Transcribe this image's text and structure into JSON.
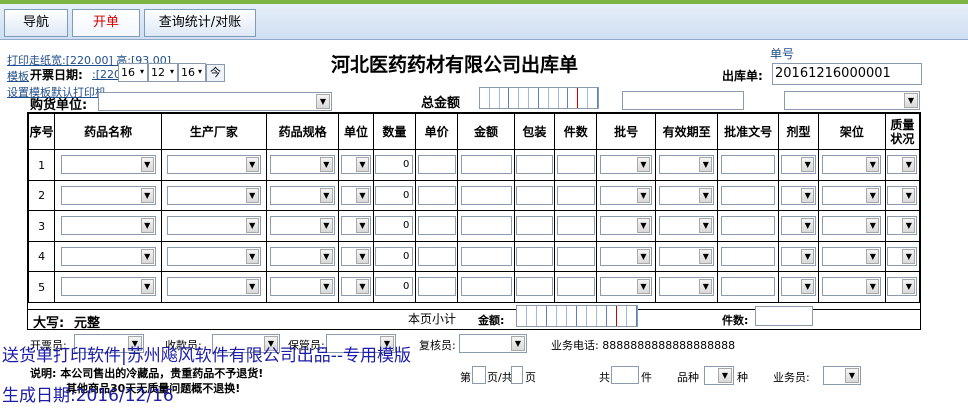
{
  "tabs": [
    {
      "label": "导航"
    },
    {
      "label": "开单"
    },
    {
      "label": "查询统计/对账"
    }
  ],
  "links": {
    "print_size": "打印走纸宽:[220.00] 高:[93.00]",
    "template": "模板",
    "template_rest": ":[220",
    "set_default": "设置模板默认打印机"
  },
  "header": {
    "company_title": "河北医药药材有限公司出库单",
    "order_no_label": "单号",
    "outbound_label": "出库单:",
    "order_no": "20161216000001",
    "open_date_label": "开票日期:",
    "date_day": "16",
    "date_month": "12",
    "date_day2": "16",
    "today_btn": "今",
    "buyer_label": "购货单位:",
    "total_label": "总金额"
  },
  "columns": [
    "序号",
    "药品名称",
    "生产厂家",
    "药品规格",
    "单位",
    "数量",
    "单价",
    "金额",
    "包装",
    "件数",
    "批号",
    "有效期至",
    "批准文号",
    "剂型",
    "架位",
    "质量状况"
  ],
  "rows": [
    {
      "no": "1",
      "qty": "0"
    },
    {
      "no": "2",
      "qty": "0"
    },
    {
      "no": "3",
      "qty": "0"
    },
    {
      "no": "4",
      "qty": "0"
    },
    {
      "no": "5",
      "qty": "0"
    }
  ],
  "footer_row": {
    "daxie": "大写:",
    "yuanzheng": "元整",
    "page_subtotal": "本页小计",
    "amount_label": "金额:",
    "pieces_label": "件数:"
  },
  "bottom": {
    "kaipiao": "开票员:",
    "shoukuan": "收款员:",
    "baoguan": "保管员:",
    "fuhe": "复核员:",
    "phone": "业务电话: 8888888888888888888",
    "notice_title": "说明: 本公司售出的冷藏品，贵重药品不予退货!",
    "notice_2": "其他商品30天无质量问题概不退换!",
    "page_prefix": "第",
    "page_mid": "页/共",
    "page_suffix": "页",
    "total_prefix": "共",
    "total_suffix": "件",
    "variety": "品种",
    "variety_suffix": "种",
    "salesman": "业务员:"
  },
  "watermark": {
    "line1": "送货单打印软件|苏州飚风软件有限公司出品--专用模版",
    "line2": "生成日期:2016/12/16"
  },
  "colors": {
    "accent_red": "#d40000",
    "watermark_blue": "#1c1ca8",
    "tab_bar": "#cfdef2",
    "green_strip": "#7db443"
  }
}
